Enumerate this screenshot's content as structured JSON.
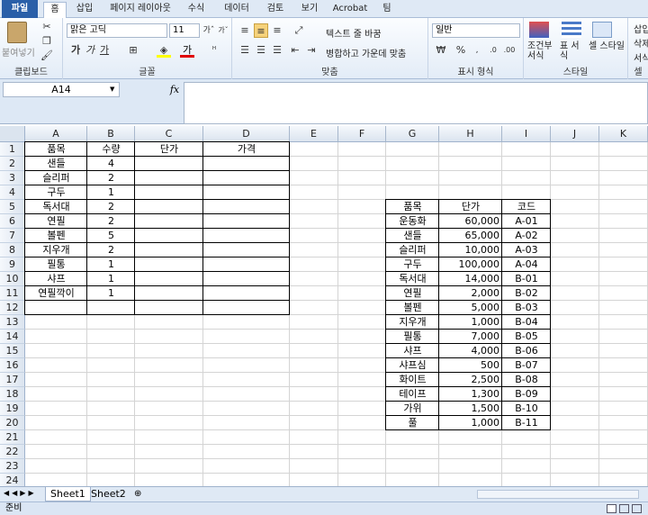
{
  "tabs": [
    "파일",
    "홈",
    "삽입",
    "페이지 레이아웃",
    "수식",
    "데이터",
    "검토",
    "보기",
    "Acrobat",
    "팀"
  ],
  "ribbon": {
    "clipboard": {
      "paste": "붙여넣기",
      "label": "클립보드"
    },
    "font": {
      "name": "맑은 고딕",
      "size": "11",
      "label": "글꼴",
      "bold": "가",
      "italic": "가",
      "underline": "가"
    },
    "align": {
      "wrap": "텍스트 줄 바꿈",
      "merge": "병합하고 가운데 맞춤",
      "label": "맞춤"
    },
    "number": {
      "format": "일반",
      "label": "표시 형식",
      "percent": "%"
    },
    "styles": {
      "cond": "조건부 서식",
      "table": "표 서식",
      "cell": "셀 스타일",
      "label": "스타일"
    },
    "cells": {
      "insert": "삽입",
      "delete": "삭제",
      "format": "서식",
      "label": "셀"
    }
  },
  "formula": {
    "namebox": "A14",
    "fx": "fx",
    "value": ""
  },
  "columns": [
    "A",
    "B",
    "C",
    "D",
    "E",
    "F",
    "G",
    "H",
    "I",
    "J",
    "K"
  ],
  "rows": [
    "1",
    "2",
    "3",
    "4",
    "5",
    "6",
    "7",
    "8",
    "9",
    "10",
    "11",
    "12",
    "13",
    "14",
    "15",
    "16",
    "17",
    "18",
    "19",
    "20",
    "21",
    "22",
    "23",
    "24"
  ],
  "table1": {
    "headers": [
      "품목",
      "수량",
      "단가",
      "가격"
    ],
    "rows": [
      [
        "샌들",
        "4"
      ],
      [
        "슬리퍼",
        "2"
      ],
      [
        "구두",
        "1"
      ],
      [
        "독서대",
        "2"
      ],
      [
        "연필",
        "2"
      ],
      [
        "볼펜",
        "5"
      ],
      [
        "지우개",
        "2"
      ],
      [
        "필통",
        "1"
      ],
      [
        "샤프",
        "1"
      ],
      [
        "연필깍이",
        "1"
      ]
    ]
  },
  "table2": {
    "headers": [
      "품목",
      "단가",
      "코드"
    ],
    "rows": [
      [
        "운동화",
        "60,000",
        "A-01"
      ],
      [
        "샌들",
        "65,000",
        "A-02"
      ],
      [
        "슬리퍼",
        "10,000",
        "A-03"
      ],
      [
        "구두",
        "100,000",
        "A-04"
      ],
      [
        "독서대",
        "14,000",
        "B-01"
      ],
      [
        "연필",
        "2,000",
        "B-02"
      ],
      [
        "볼펜",
        "5,000",
        "B-03"
      ],
      [
        "지우개",
        "1,000",
        "B-04"
      ],
      [
        "필통",
        "7,000",
        "B-05"
      ],
      [
        "샤프",
        "4,000",
        "B-06"
      ],
      [
        "샤프심",
        "500",
        "B-07"
      ],
      [
        "화이트",
        "2,500",
        "B-08"
      ],
      [
        "테이프",
        "1,300",
        "B-09"
      ],
      [
        "가위",
        "1,500",
        "B-10"
      ],
      [
        "풀",
        "1,000",
        "B-11"
      ]
    ]
  },
  "sheets": [
    "Sheet1",
    "Sheet2"
  ],
  "status": "준비",
  "colors": {
    "file_tab": "#2a5fa8",
    "ribbon_bg": "#e3ecf7"
  }
}
